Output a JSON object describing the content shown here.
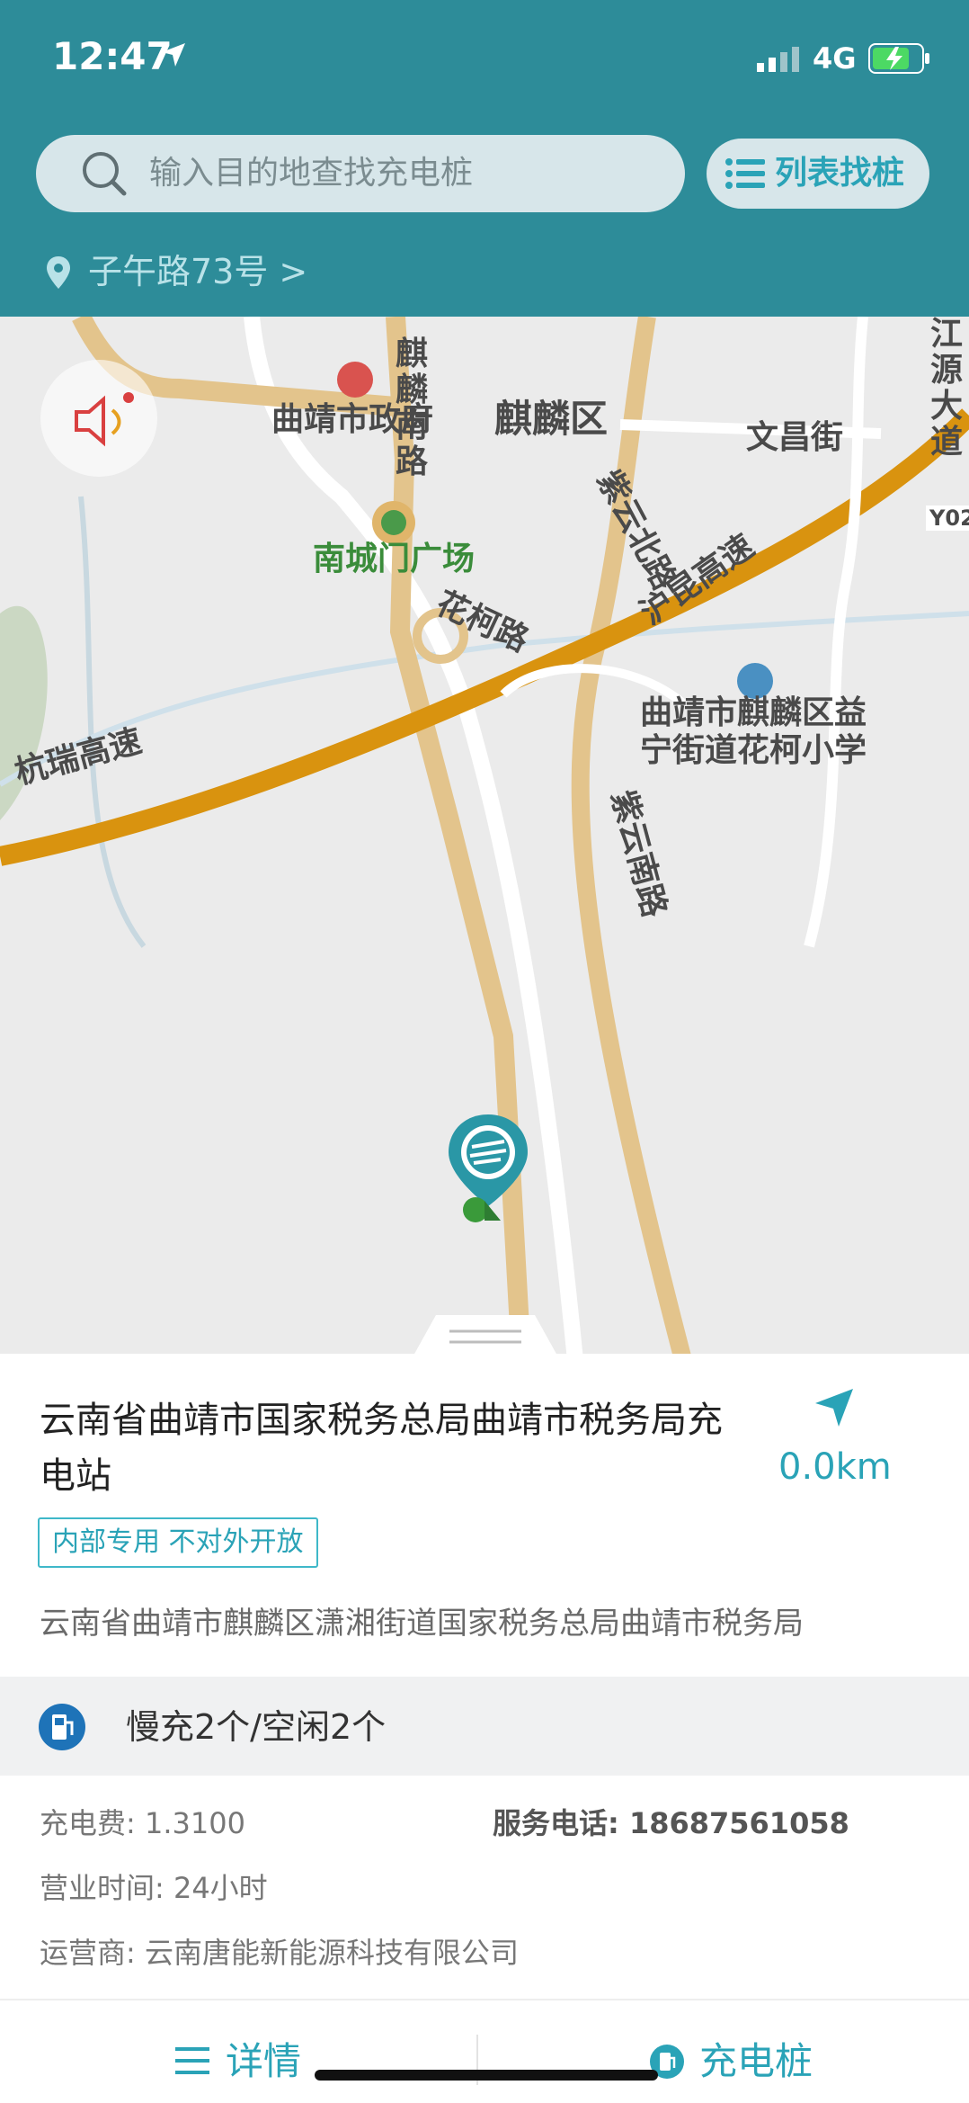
{
  "status_bar": {
    "time": "12:47",
    "network": "4G"
  },
  "search": {
    "placeholder": "输入目的地查找充电桩"
  },
  "list_button": {
    "label": "列表找桩"
  },
  "location": {
    "current_address": "子午路73号 >"
  },
  "map": {
    "labels": {
      "qilin_south_road": "麒\n麟\n南\n路",
      "qilin_district": "麒麟区",
      "zijin_north": "紫云北路",
      "city_gov": "曲靖市政府",
      "wenchang_street": "文昌街",
      "nanchengmen": "南城门广场",
      "hanke_road": "花柯路",
      "hukun_expressway": "沪昆高速",
      "hangrui_expressway": "杭瑞高速",
      "school": "曲靖市麒麟区益\n宁街道花柯小学",
      "zijin_south": "紫云南路",
      "jiangyuan_avenue": "江\n源\n大\n道",
      "y02": "Y02"
    }
  },
  "station": {
    "title": "云南省曲靖市国家税务总局曲靖市税务局充电站",
    "distance": "0.0km",
    "badge": "内部专用 不对外开放",
    "address": "云南省曲靖市麒麟区潇湘街道国家税务总局曲靖市税务局",
    "slow_charge": "慢充2个/空闲2个",
    "fee": "充电费: 1.3100",
    "phone": "服务电话: 18687561058",
    "hours": "营业时间: 24小时",
    "operator": "运营商: 云南唐能新能源科技有限公司"
  },
  "tabs": {
    "detail": "详情",
    "piles": "充电桩"
  },
  "colors": {
    "header": "#2d8c99",
    "accent": "#2aa3b7",
    "road_highway": "#d9930f",
    "road_main": "#e3c48c"
  },
  "icons": [
    "location-arrow-icon",
    "signal-icon",
    "battery-icon",
    "search-icon",
    "list-icon",
    "location-pin-icon",
    "sound-icon",
    "charging-pin-icon",
    "navigate-icon",
    "charger-icon",
    "menu-icon"
  ]
}
